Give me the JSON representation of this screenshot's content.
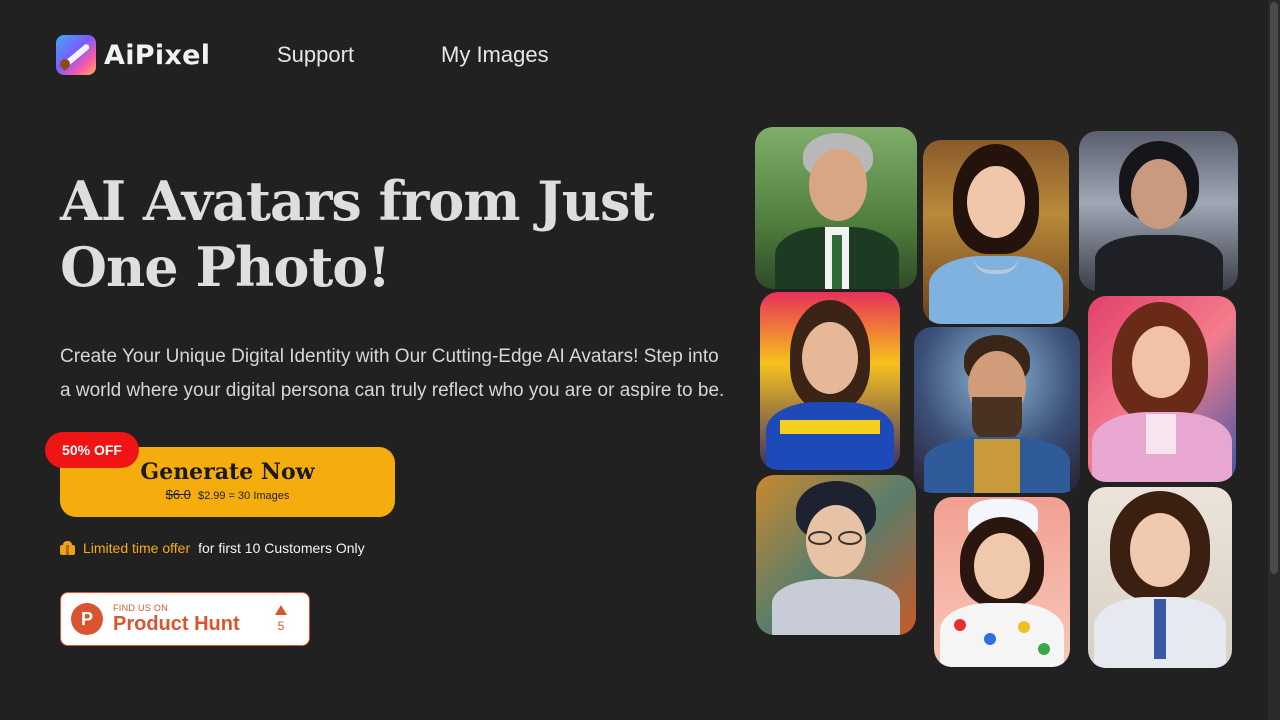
{
  "header": {
    "brand": "AiPixel",
    "nav": {
      "support": "Support",
      "my_images": "My Images"
    }
  },
  "hero": {
    "title": "AI Avatars from Just One Photo!",
    "subtitle": "Create Your Unique Digital Identity with Our Cutting-Edge AI Avatars! Step into a world where your digital persona can truly reflect who you are or aspire to be."
  },
  "cta": {
    "label": "Generate Now",
    "old_price": "$6.0",
    "price_detail": "$2.99 = 30 Images",
    "badge": "50% OFF"
  },
  "offer": {
    "icon": "gift-icon",
    "highlight": "Limited time offer",
    "rest": "for first 10 Customers Only"
  },
  "product_hunt": {
    "small": "FIND US ON",
    "big": "Product Hunt",
    "letter": "P",
    "votes": "5"
  },
  "colors": {
    "background": "#212121",
    "accent": "#f5ad0d",
    "badge": "#f01414",
    "product_hunt": "#da552f"
  },
  "avatars": [
    "avatar-man-suit",
    "avatar-princess",
    "avatar-woman-storm",
    "avatar-girl-sports",
    "avatar-bearded-wizard",
    "avatar-woman-pink-blazer",
    "avatar-boy-glasses",
    "avatar-girl-polka-dots",
    "avatar-girl-uniform"
  ]
}
